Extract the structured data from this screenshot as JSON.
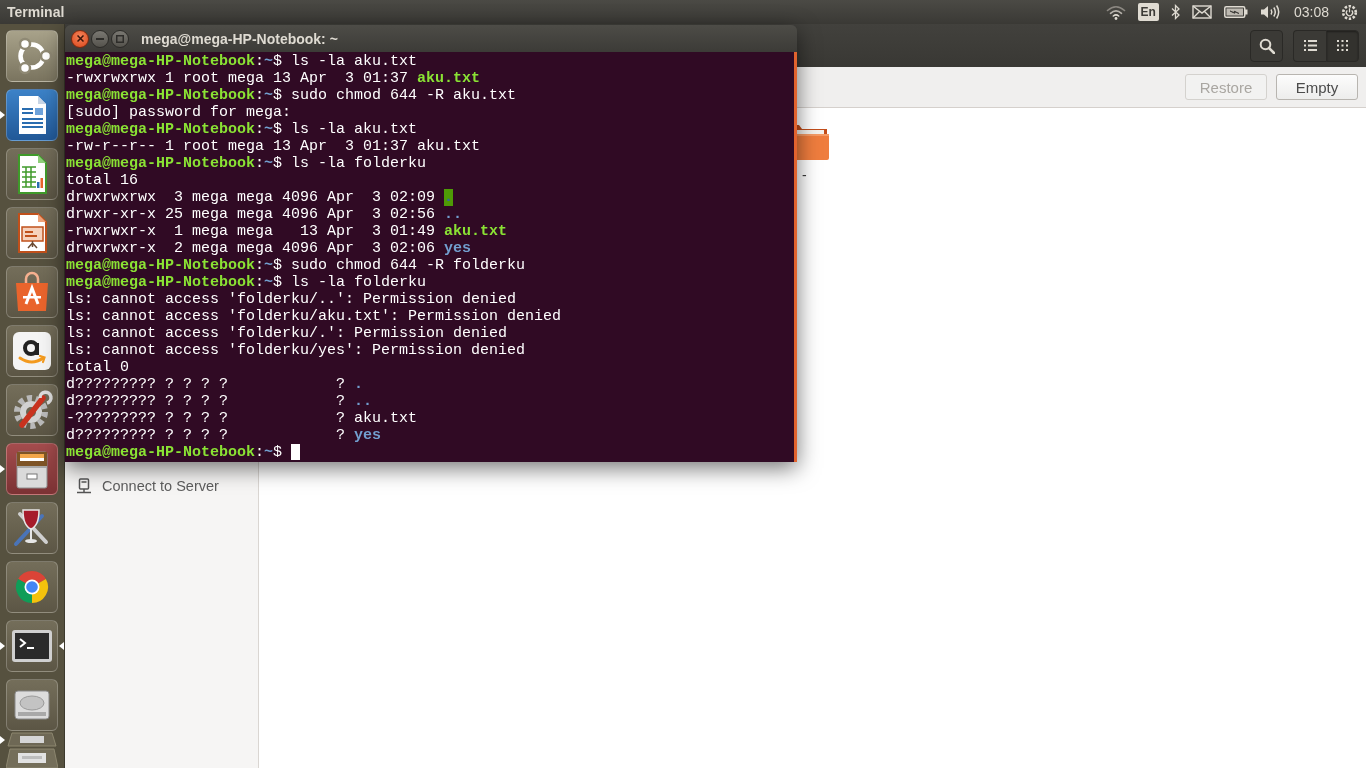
{
  "top_panel": {
    "app_title": "Terminal",
    "keyboard_layout": "En",
    "clock": "03:08"
  },
  "launcher": {
    "items": [
      {
        "kind": "tile",
        "running": false,
        "focused": false,
        "highlighted": false
      },
      {
        "kind": "tile",
        "running": true,
        "focused": false,
        "highlighted": false
      },
      {
        "kind": "tile",
        "running": false,
        "focused": false,
        "highlighted": false
      },
      {
        "kind": "tile",
        "running": false,
        "focused": false,
        "highlighted": false
      },
      {
        "kind": "tile",
        "running": false,
        "focused": false,
        "highlighted": false
      },
      {
        "kind": "tile",
        "running": false,
        "focused": false,
        "highlighted": false
      },
      {
        "kind": "tile",
        "running": false,
        "focused": false,
        "highlighted": false
      },
      {
        "kind": "tile",
        "running": true,
        "focused": false,
        "highlighted": true
      },
      {
        "kind": "tile",
        "running": false,
        "focused": false,
        "highlighted": false
      },
      {
        "kind": "tile",
        "running": false,
        "focused": false,
        "highlighted": false
      },
      {
        "kind": "tile",
        "running": true,
        "focused": true,
        "highlighted": false
      },
      {
        "kind": "tile",
        "running": false,
        "focused": false,
        "highlighted": false
      },
      {
        "kind": "folded",
        "running": true,
        "focused": false,
        "highlighted": false
      }
    ]
  },
  "files_window": {
    "view_buttons": [
      {
        "selected": false
      },
      {
        "selected": true
      }
    ],
    "toolbar_buttons": [
      {
        "label": "Restore",
        "disabled": true
      },
      {
        "label": "Empty",
        "disabled": false
      }
    ],
    "sidebar": {
      "items": [
        {
          "label": "Connect to Server"
        }
      ]
    },
    "content_items": [
      {
        "name": "-"
      }
    ]
  },
  "terminal": {
    "title": "mega@mega-HP-Notebook: ~",
    "cursor": true,
    "lines": [
      {
        "segments": [
          {
            "text": "mega@mega-HP-Notebook",
            "kind": "prompt"
          },
          {
            "text": ":",
            "kind": "plain"
          },
          {
            "text": "~",
            "kind": "path"
          },
          {
            "text": "$ ls -la aku.txt",
            "kind": "plain"
          }
        ]
      },
      {
        "segments": [
          {
            "text": "-rwxrwxrwx 1 root mega 13 Apr  3 01:37 ",
            "kind": "plain"
          },
          {
            "text": "aku.txt",
            "kind": "exec"
          }
        ]
      },
      {
        "segments": [
          {
            "text": "mega@mega-HP-Notebook",
            "kind": "prompt"
          },
          {
            "text": ":",
            "kind": "plain"
          },
          {
            "text": "~",
            "kind": "path"
          },
          {
            "text": "$ sudo chmod 644 -R aku.txt",
            "kind": "plain"
          }
        ]
      },
      {
        "segments": [
          {
            "text": "[sudo] password for mega:",
            "kind": "plain"
          }
        ]
      },
      {
        "segments": [
          {
            "text": "mega@mega-HP-Notebook",
            "kind": "prompt"
          },
          {
            "text": ":",
            "kind": "plain"
          },
          {
            "text": "~",
            "kind": "path"
          },
          {
            "text": "$ ls -la aku.txt",
            "kind": "plain"
          }
        ]
      },
      {
        "segments": [
          {
            "text": "-rw-r--r-- 1 root mega 13 Apr  3 01:37 aku.txt",
            "kind": "plain"
          }
        ]
      },
      {
        "segments": [
          {
            "text": "mega@mega-HP-Notebook",
            "kind": "prompt"
          },
          {
            "text": ":",
            "kind": "plain"
          },
          {
            "text": "~",
            "kind": "path"
          },
          {
            "text": "$ ls -la folderku",
            "kind": "plain"
          }
        ]
      },
      {
        "segments": [
          {
            "text": "total 16",
            "kind": "plain"
          }
        ]
      },
      {
        "segments": [
          {
            "text": "drwxrwxrwx  3 mega mega 4096 Apr  3 02:09 ",
            "kind": "plain"
          },
          {
            "text": ".",
            "kind": "dir_ow"
          }
        ]
      },
      {
        "segments": [
          {
            "text": "drwxr-xr-x 25 mega mega 4096 Apr  3 02:56 ",
            "kind": "plain"
          },
          {
            "text": "..",
            "kind": "dir"
          }
        ]
      },
      {
        "segments": [
          {
            "text": "-rwxrwxr-x  1 mega mega   13 Apr  3 01:49 ",
            "kind": "plain"
          },
          {
            "text": "aku.txt",
            "kind": "exec"
          }
        ]
      },
      {
        "segments": [
          {
            "text": "drwxrwxr-x  2 mega mega 4096 Apr  3 02:06 ",
            "kind": "plain"
          },
          {
            "text": "yes",
            "kind": "dir"
          }
        ]
      },
      {
        "segments": [
          {
            "text": "mega@mega-HP-Notebook",
            "kind": "prompt"
          },
          {
            "text": ":",
            "kind": "plain"
          },
          {
            "text": "~",
            "kind": "path"
          },
          {
            "text": "$ sudo chmod 644 -R folderku",
            "kind": "plain"
          }
        ]
      },
      {
        "segments": [
          {
            "text": "mega@mega-HP-Notebook",
            "kind": "prompt"
          },
          {
            "text": ":",
            "kind": "plain"
          },
          {
            "text": "~",
            "kind": "path"
          },
          {
            "text": "$ ls -la folderku",
            "kind": "plain"
          }
        ]
      },
      {
        "segments": [
          {
            "text": "ls: cannot access 'folderku/..': Permission denied",
            "kind": "plain"
          }
        ]
      },
      {
        "segments": [
          {
            "text": "ls: cannot access 'folderku/aku.txt': Permission denied",
            "kind": "plain"
          }
        ]
      },
      {
        "segments": [
          {
            "text": "ls: cannot access 'folderku/.': Permission denied",
            "kind": "plain"
          }
        ]
      },
      {
        "segments": [
          {
            "text": "ls: cannot access 'folderku/yes': Permission denied",
            "kind": "plain"
          }
        ]
      },
      {
        "segments": [
          {
            "text": "total 0",
            "kind": "plain"
          }
        ]
      },
      {
        "segments": [
          {
            "text": "d????????? ? ? ? ?            ? ",
            "kind": "plain"
          },
          {
            "text": ".",
            "kind": "dir"
          }
        ]
      },
      {
        "segments": [
          {
            "text": "d????????? ? ? ? ?            ? ",
            "kind": "plain"
          },
          {
            "text": "..",
            "kind": "dir"
          }
        ]
      },
      {
        "segments": [
          {
            "text": "-????????? ? ? ? ?            ? aku.txt",
            "kind": "plain"
          }
        ]
      },
      {
        "segments": [
          {
            "text": "d????????? ? ? ? ?            ? ",
            "kind": "plain"
          },
          {
            "text": "yes",
            "kind": "dir"
          }
        ]
      },
      {
        "segments": [
          {
            "text": "mega@mega-HP-Notebook",
            "kind": "prompt"
          },
          {
            "text": ":",
            "kind": "plain"
          },
          {
            "text": "~",
            "kind": "path"
          },
          {
            "text": "$",
            "kind": "plain"
          }
        ]
      }
    ]
  }
}
